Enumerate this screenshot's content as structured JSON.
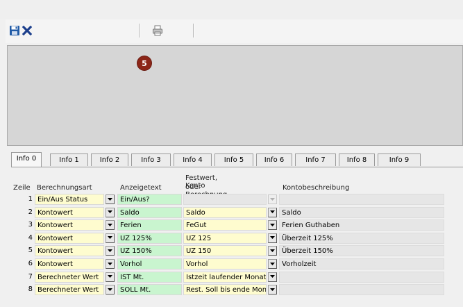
{
  "toolbar": {
    "save_icon": "save-icon",
    "close_icon": "close-icon",
    "print_icon": "print-icon"
  },
  "panel": {
    "badge": "5"
  },
  "tabs": [
    "Info 0",
    "Info 1",
    "Info 2",
    "Info 3",
    "Info 4",
    "Info 5",
    "Info 6",
    "Info 7",
    "Info 8",
    "Info 9"
  ],
  "active_tab": "Info 0",
  "table": {
    "headers": {
      "zeile": "Zeile",
      "berechnungsart": "Berechnungsart",
      "anzeigetext": "Anzeigetext",
      "festwert_line1": "Festwert, Konto",
      "festwert_line2": "oder Berechnung",
      "kontobeschreibung": "Kontobeschreibung"
    },
    "rows": [
      {
        "zeile": "1",
        "berechnungsart": "Ein/Aus Status",
        "anzeigetext": "Ein/Aus?",
        "festwert": "",
        "kontobeschreibung": ""
      },
      {
        "zeile": "2",
        "berechnungsart": "Kontowert",
        "anzeigetext": "Saldo",
        "festwert": "Saldo",
        "kontobeschreibung": "Saldo"
      },
      {
        "zeile": "3",
        "berechnungsart": "Kontowert",
        "anzeigetext": "Ferien",
        "festwert": "FeGut",
        "kontobeschreibung": "Ferien Guthaben"
      },
      {
        "zeile": "4",
        "berechnungsart": "Kontowert",
        "anzeigetext": "UZ 125%",
        "festwert": "UZ 125",
        "kontobeschreibung": "Überzeit 125%"
      },
      {
        "zeile": "5",
        "berechnungsart": "Kontowert",
        "anzeigetext": "UZ 150%",
        "festwert": "UZ 150",
        "kontobeschreibung": "Überzeit 150%"
      },
      {
        "zeile": "6",
        "berechnungsart": "Kontowert",
        "anzeigetext": "Vorhol",
        "festwert": "Vorhol",
        "kontobeschreibung": "Vorholzeit"
      },
      {
        "zeile": "7",
        "berechnungsart": "Berechneter Wert",
        "anzeigetext": "IST Mt.",
        "festwert": "Istzeit laufender Monat",
        "kontobeschreibung": ""
      },
      {
        "zeile": "8",
        "berechnungsart": "Berechneter Wert",
        "anzeigetext": "SOLL Mt.",
        "festwert": "Rest. Soll bis ende Mon.",
        "kontobeschreibung": ""
      }
    ]
  },
  "colors": {
    "yellow_field": "#fefccf",
    "green_field": "#c9f5cf",
    "grey_field": "#e6e6e6",
    "badge": "#8c2618",
    "save_icon_blue": "#1f5aa6"
  }
}
